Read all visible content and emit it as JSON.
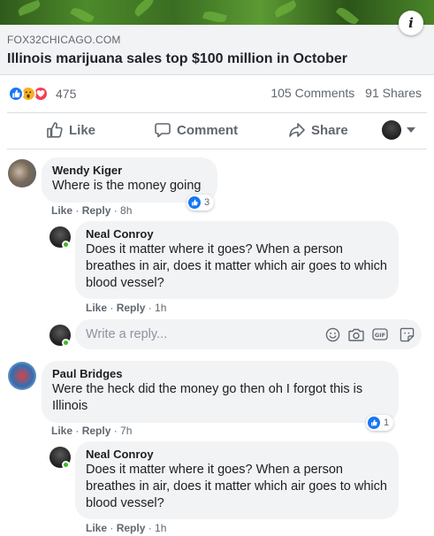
{
  "link": {
    "domain": "FOX32CHICAGO.COM",
    "headline": "Illinois marijuana sales top $100 million in October",
    "info_icon": "i"
  },
  "stats": {
    "reactions": [
      "like",
      "wow",
      "love"
    ],
    "reaction_count": "475",
    "comments": "105 Comments",
    "shares": "91 Shares"
  },
  "actions": {
    "like": "Like",
    "comment": "Comment",
    "share": "Share"
  },
  "comments": [
    {
      "author": "Wendy Kiger",
      "text": "Where is the money going",
      "like": "Like",
      "reply": "Reply",
      "time": "8h",
      "like_count": "3",
      "replies": [
        {
          "author": "Neal Conroy",
          "text": "Does it matter where it goes? When a person breathes in air, does it matter which air goes to which blood vessel?",
          "like": "Like",
          "reply": "Reply",
          "time": "1h"
        }
      ]
    },
    {
      "author": "Paul Bridges",
      "text": "Were the heck did the money go then oh I forgot this is Illinois",
      "like": "Like",
      "reply": "Reply",
      "time": "7h",
      "like_count": "1",
      "replies": [
        {
          "author": "Neal Conroy",
          "text": "Does it matter where it goes? When a person breathes in air, does it matter which air goes to which blood vessel?",
          "like": "Like",
          "reply": "Reply",
          "time": "1h"
        }
      ]
    }
  ],
  "reply_box": {
    "placeholder": "Write a reply..."
  },
  "colors": {
    "like_blue": "#1877f2",
    "text_secondary": "#606770",
    "bubble_bg": "#f2f3f5"
  },
  "icons": [
    "info-icon",
    "like-icon",
    "comment-icon",
    "share-icon",
    "caret-down-icon",
    "emoji-icon",
    "camera-icon",
    "gif-icon",
    "sticker-icon"
  ]
}
